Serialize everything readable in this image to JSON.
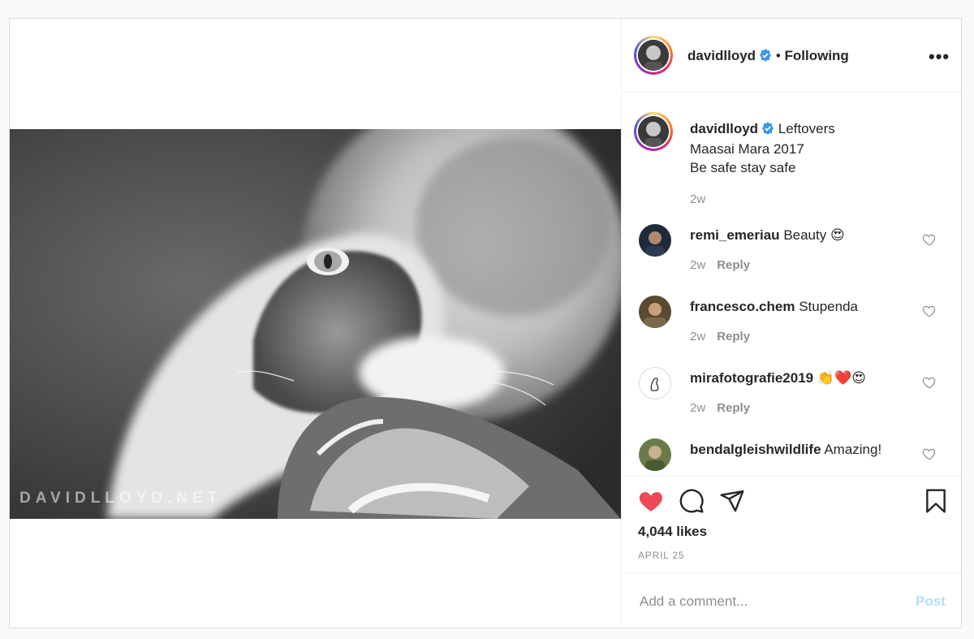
{
  "post": {
    "username": "davidlloyd",
    "follow_state": "Following",
    "separator": "•",
    "watermark": "DAVIDLLOYD.NET",
    "caption": {
      "username": "davidlloyd",
      "line1": "Leftovers",
      "line2": "Maasai Mara 2017",
      "line3": "Be safe stay safe",
      "time": "2w"
    },
    "comments": [
      {
        "username": "remi_emeriau",
        "text": "Beauty 😍",
        "time": "2w",
        "reply": "Reply"
      },
      {
        "username": "francesco.chem",
        "text": "Stupenda",
        "time": "2w",
        "reply": "Reply"
      },
      {
        "username": "mirafotografie2019",
        "text": "👏❤️😍",
        "time": "2w",
        "reply": "Reply"
      },
      {
        "username": "bendalgleishwildlife",
        "text": "Amazing!",
        "time": "",
        "reply": ""
      }
    ],
    "likes": "4,044 likes",
    "date": "APRIL 25",
    "add_comment_placeholder": "Add a comment...",
    "post_label": "Post",
    "liked": true
  },
  "colors": {
    "verified": "#3897f0",
    "heart_liked": "#ed4956",
    "post_button": "#b2dffc",
    "secondary_text": "#8e8e8e"
  },
  "icons": [
    "verified-badge-icon",
    "more-options-icon",
    "heart-icon",
    "comment-icon",
    "share-icon",
    "save-icon"
  ]
}
